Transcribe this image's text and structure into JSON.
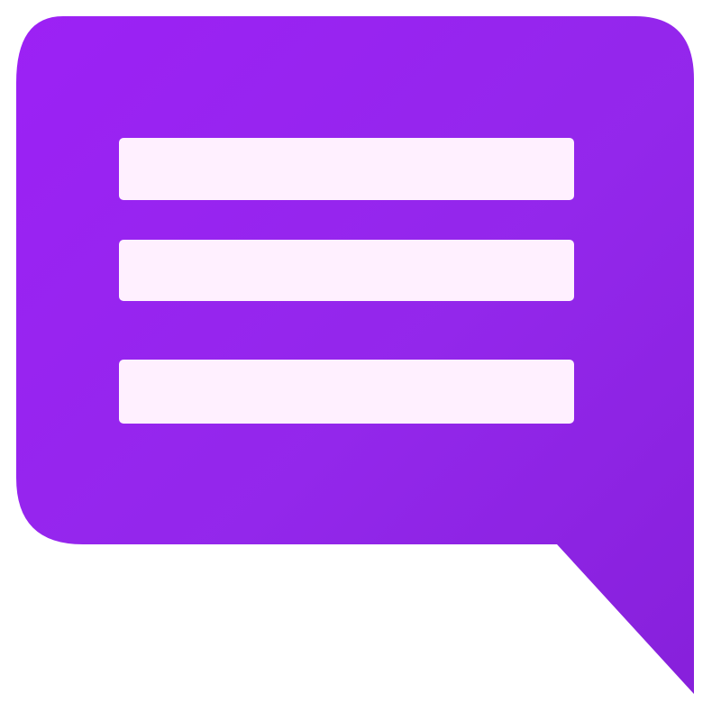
{
  "icon": {
    "name": "message-lines-icon",
    "colors": {
      "background": "#FFFFFF",
      "bubble_fill": "#9A22F2",
      "bubble_shade": "#8E1FE6",
      "line_fill": "#FFF0FF"
    }
  }
}
